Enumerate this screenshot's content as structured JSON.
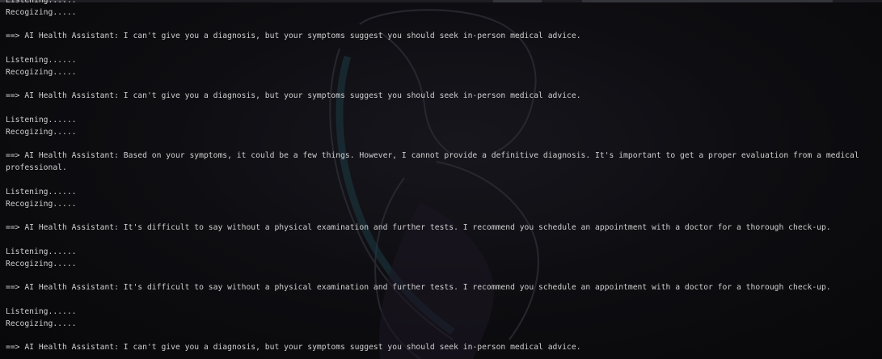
{
  "terminal": {
    "lines": [
      {
        "kind": "status",
        "text": "Listening......"
      },
      {
        "kind": "status",
        "text": "Recogizing....."
      },
      {
        "kind": "blank",
        "text": ""
      },
      {
        "kind": "response",
        "text": "==> AI Health Assistant: I can't give you a diagnosis, but your symptoms suggest you should seek in-person medical advice."
      },
      {
        "kind": "blank",
        "text": ""
      },
      {
        "kind": "status",
        "text": "Listening......"
      },
      {
        "kind": "status",
        "text": "Recogizing....."
      },
      {
        "kind": "blank",
        "text": ""
      },
      {
        "kind": "response",
        "text": "==> AI Health Assistant: I can't give you a diagnosis, but your symptoms suggest you should seek in-person medical advice."
      },
      {
        "kind": "blank",
        "text": ""
      },
      {
        "kind": "status",
        "text": "Listening......"
      },
      {
        "kind": "status",
        "text": "Recogizing....."
      },
      {
        "kind": "blank",
        "text": ""
      },
      {
        "kind": "response",
        "text": "==> AI Health Assistant: Based on your symptoms, it could be a few things. However, I cannot provide a definitive diagnosis. It's important to get a proper evaluation from a medical"
      },
      {
        "kind": "response",
        "text": "professional."
      },
      {
        "kind": "blank",
        "text": ""
      },
      {
        "kind": "status",
        "text": "Listening......"
      },
      {
        "kind": "status",
        "text": "Recogizing....."
      },
      {
        "kind": "blank",
        "text": ""
      },
      {
        "kind": "response",
        "text": "==> AI Health Assistant: It's difficult to say without a physical examination and further tests. I recommend you schedule an appointment with a doctor for a thorough check-up."
      },
      {
        "kind": "blank",
        "text": ""
      },
      {
        "kind": "status",
        "text": "Listening......"
      },
      {
        "kind": "status",
        "text": "Recogizing....."
      },
      {
        "kind": "blank",
        "text": ""
      },
      {
        "kind": "response",
        "text": "==> AI Health Assistant: It's difficult to say without a physical examination and further tests. I recommend you schedule an appointment with a doctor for a thorough check-up."
      },
      {
        "kind": "blank",
        "text": ""
      },
      {
        "kind": "status",
        "text": "Listening......"
      },
      {
        "kind": "status",
        "text": "Recogizing....."
      },
      {
        "kind": "blank",
        "text": ""
      },
      {
        "kind": "response",
        "text": "==> AI Health Assistant: I can't give you a diagnosis, but your symptoms suggest you should seek in-person medical advice."
      }
    ]
  },
  "colors": {
    "background": "#0c0c0c",
    "text": "#cfcfcf",
    "wallpaper_line": "#2a2a33"
  }
}
